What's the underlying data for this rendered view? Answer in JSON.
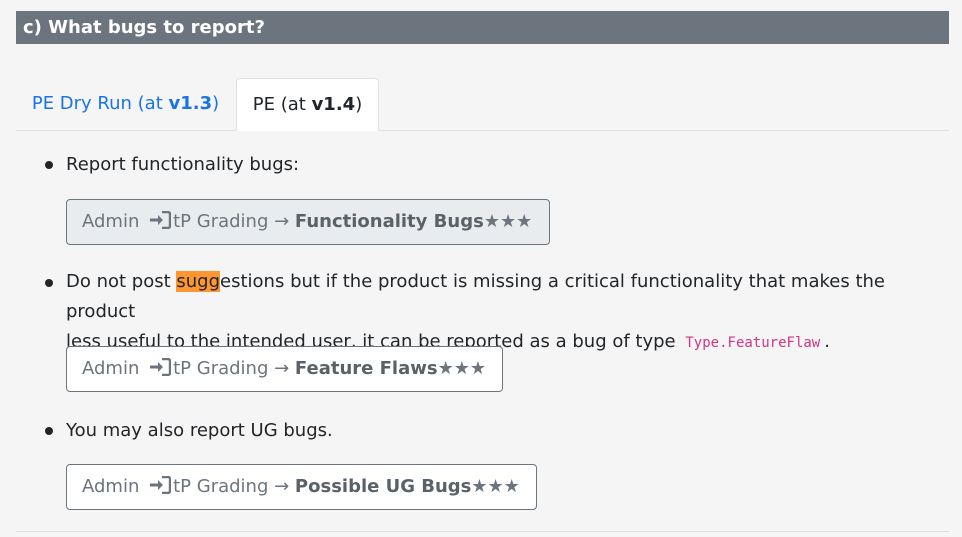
{
  "section": {
    "title": "c) What bugs to report?"
  },
  "tabs": [
    {
      "prefix": "PE Dry Run (at ",
      "version": "v1.3",
      "suffix": ")",
      "active": false
    },
    {
      "prefix": "PE (at ",
      "version": "v1.4",
      "suffix": ")",
      "active": true
    }
  ],
  "items": [
    {
      "text": "Report functionality bugs:",
      "button": {
        "prefix": "Admin",
        "middle": "tP Grading →",
        "dest": "Functionality Bugs",
        "stars": "★★★"
      }
    },
    {
      "text_before": "Do not post ",
      "text_highlight": "sugg",
      "text_after": "estions but if the product is missing a critical functionality that makes the product",
      "text_line2": "less useful to the intended user, it can be reported as a bug of type",
      "code": "Type.FeatureFlaw",
      "text_end": ".",
      "button": {
        "prefix": "Admin",
        "middle": "tP Grading →",
        "dest": "Feature Flaws",
        "stars": "★★★"
      }
    },
    {
      "text": "You may also report UG bugs.",
      "button": {
        "prefix": "Admin",
        "middle": "tP Grading →",
        "dest": "Possible UG Bugs",
        "stars": "★★★"
      }
    }
  ],
  "colors": {
    "header_bg": "#6c757d",
    "tab_link": "#1a73e8",
    "highlight": "#ff9632",
    "code": "#d63384"
  },
  "icons": {
    "login": "login-icon"
  }
}
